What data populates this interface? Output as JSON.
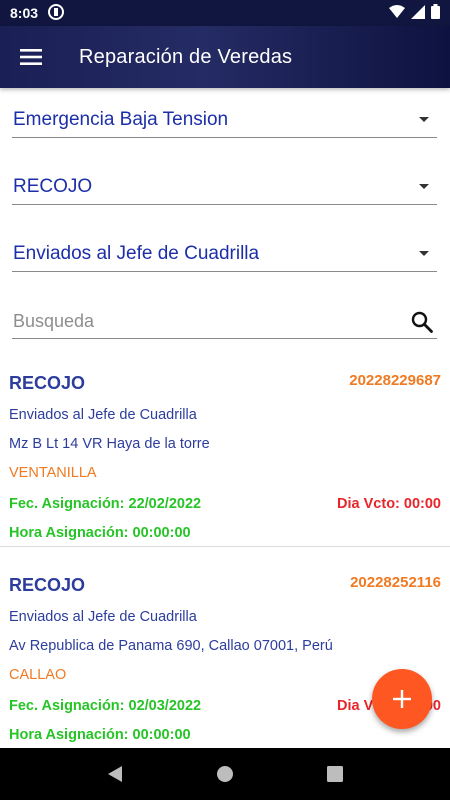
{
  "status_bar": {
    "time": "8:03"
  },
  "app_bar": {
    "title": "Reparación de Veredas"
  },
  "filters": {
    "category": "Emergencia Baja Tension",
    "type": "RECOJO",
    "state": "Enviados al Jefe de Cuadrilla"
  },
  "search": {
    "placeholder": "Busqueda",
    "value": ""
  },
  "records": [
    {
      "type": "RECOJO",
      "code": "20228229687",
      "status": "Enviados al Jefe de Cuadrilla",
      "address": "Mz B Lt 14 VR Haya de la torre",
      "district": "VENTANILLA",
      "fec_asignacion": "Fec. Asignación: 22/02/2022",
      "dia_vcto": "Dia Vcto: 00:00",
      "hora_asignacion": "Hora Asignación: 00:00:00"
    },
    {
      "type": "RECOJO",
      "code": "20228252116",
      "status": "Enviados al Jefe de Cuadrilla",
      "address": "Av Republica de Panama 690, Callao 07001, Perú",
      "district": "CALLAO",
      "fec_asignacion": "Fec. Asignación: 02/03/2022",
      "dia_vcto": "Dia Vcto: 00:00",
      "hora_asignacion": "Hora Asignación: 00:00:00"
    }
  ],
  "colors": {
    "primary_dark": "#1a1f55",
    "label_blue": "#2c3d9c",
    "orange": "#f07a22",
    "green": "#27c427",
    "red": "#e8252a",
    "fab": "#ff5722"
  },
  "icons": {
    "menu": "hamburger-icon",
    "search": "search-icon",
    "fab": "plus-icon",
    "nav_back": "back-triangle-icon",
    "nav_home": "home-circle-icon",
    "nav_recents": "recents-square-icon"
  }
}
